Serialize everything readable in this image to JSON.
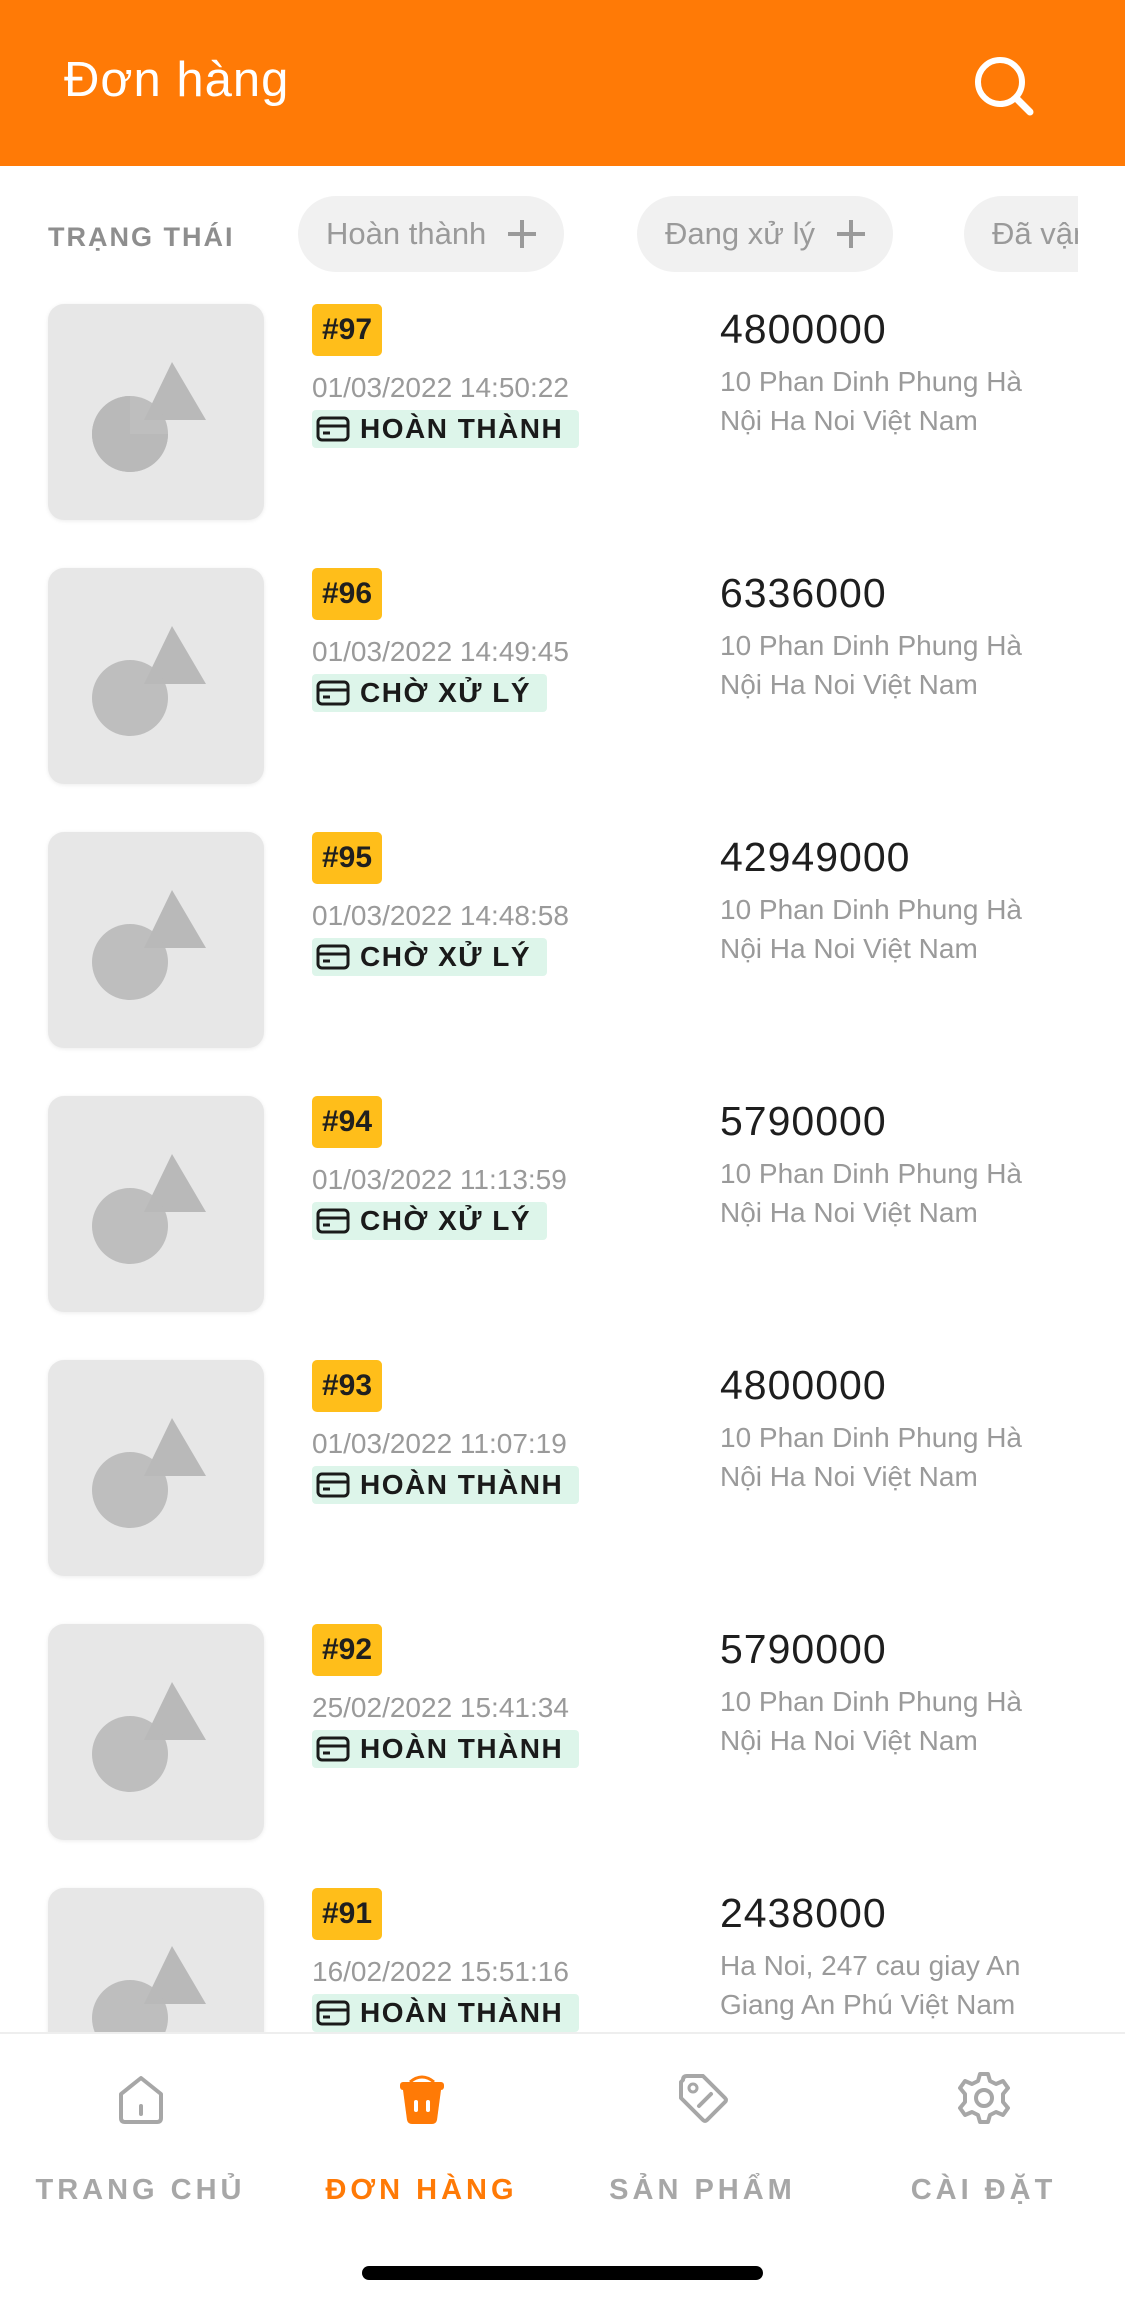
{
  "header": {
    "title": "Đơn hàng"
  },
  "filters": {
    "label": "TRẠNG THÁI",
    "chips": [
      "Hoàn thành",
      "Đang xử lý",
      "Đã vận chuyển"
    ]
  },
  "orders": [
    {
      "id": "#97",
      "date": "01/03/2022 14:50:22",
      "status": "HOÀN THÀNH",
      "amount": "4800000",
      "address": "10 Phan Dinh Phung Hà Nội Ha Noi Việt Nam"
    },
    {
      "id": "#96",
      "date": "01/03/2022 14:49:45",
      "status": "CHỜ XỬ LÝ",
      "amount": "6336000",
      "address": "10 Phan Dinh Phung Hà Nội Ha Noi Việt Nam"
    },
    {
      "id": "#95",
      "date": "01/03/2022 14:48:58",
      "status": "CHỜ XỬ LÝ",
      "amount": "42949000",
      "address": "10 Phan Dinh Phung Hà Nội Ha Noi Việt Nam"
    },
    {
      "id": "#94",
      "date": "01/03/2022 11:13:59",
      "status": "CHỜ XỬ LÝ",
      "amount": "5790000",
      "address": "10 Phan Dinh Phung Hà Nội Ha Noi Việt Nam"
    },
    {
      "id": "#93",
      "date": "01/03/2022 11:07:19",
      "status": "HOÀN THÀNH",
      "amount": "4800000",
      "address": "10 Phan Dinh Phung Hà Nội Ha Noi Việt Nam"
    },
    {
      "id": "#92",
      "date": "25/02/2022 15:41:34",
      "status": "HOÀN THÀNH",
      "amount": "5790000",
      "address": "10 Phan Dinh Phung Hà Nội Ha Noi Việt Nam"
    },
    {
      "id": "#91",
      "date": "16/02/2022 15:51:16",
      "status": "HOÀN THÀNH",
      "amount": "2438000",
      "address": "Ha Noi, 247 cau giay An Giang An Phú Việt Nam"
    }
  ],
  "tabs": [
    {
      "label": "TRANG CHỦ",
      "icon": "home-icon",
      "active": false
    },
    {
      "label": "ĐƠN HÀNG",
      "icon": "basket-icon",
      "active": true
    },
    {
      "label": "SẢN PHẨM",
      "icon": "tag-icon",
      "active": false
    },
    {
      "label": "CÀI ĐẶT",
      "icon": "settings-icon",
      "active": false
    }
  ],
  "colors": {
    "brand": "#FF7A06",
    "id_badge": "#FFBE1A",
    "status_badge": "#DDF5EA",
    "muted_text": "#9A9A9A"
  }
}
